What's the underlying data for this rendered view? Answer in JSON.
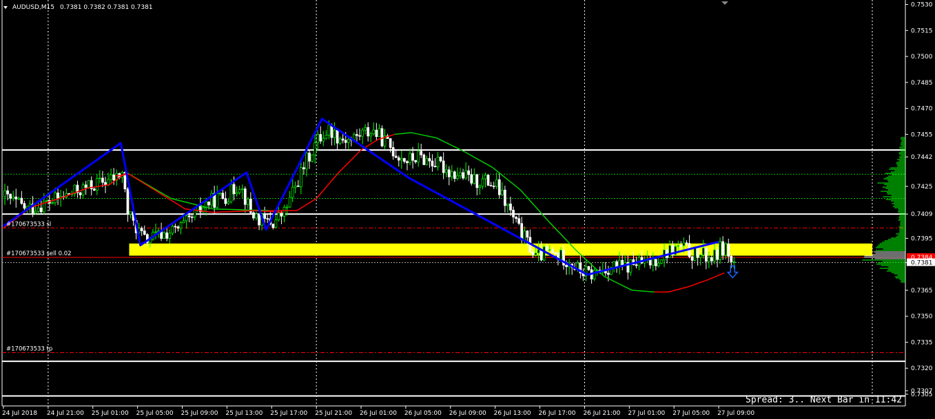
{
  "header": {
    "symbol": "AUDUSD,M15",
    "ohlc": "0.7381 0.7382 0.7381 0.7381"
  },
  "status": {
    "spread": "Spread: 3.. Next Bar in 11:42"
  },
  "orders": {
    "sl_label": "#170673533 sl",
    "sell_label": "#170673533 sell 0.02",
    "tp_label": "#170673533 tp"
  },
  "colors": {
    "background": "#000000",
    "bull_candle": "#00ff00",
    "bear_candle": "#ffffff",
    "zigzag": "#0000ff",
    "ma_green": "#00cc00",
    "ma_red": "#ff0000",
    "zone": "#ffff00",
    "order_line": "#ff0000",
    "grid": "#ffffff",
    "volume_profile": "#00ff00",
    "bid_badge": "#ff0000",
    "arrow": "#1e64ff"
  },
  "chart_data": {
    "type": "candlestick",
    "symbol": "AUDUSD",
    "timeframe": "M15",
    "ylim": [
      0.7303,
      0.7531
    ],
    "yticks": [
      "0.7530",
      "0.7515",
      "0.7500",
      "0.7485",
      "0.7470",
      "0.7455",
      "0.7442",
      "0.7425",
      "0.7409",
      "0.7395",
      "0.7381",
      "0.7365",
      "0.7350",
      "0.7335",
      "0.7320",
      "0.7307",
      "0.7305"
    ],
    "y_tick_values": [
      0.753,
      0.7515,
      0.75,
      0.7485,
      0.747,
      0.7455,
      0.7442,
      0.7425,
      0.7409,
      0.7395,
      0.7381,
      0.7365,
      0.735,
      0.7335,
      0.732,
      0.7307,
      0.7305
    ],
    "xticks": [
      "24 Jul 2018",
      "24 Jul 21:00",
      "25 Jul 01:00",
      "25 Jul 05:00",
      "25 Jul 09:00",
      "25 Jul 13:00",
      "25 Jul 17:00",
      "25 Jul 21:00",
      "26 Jul 01:00",
      "26 Jul 05:00",
      "26 Jul 09:00",
      "26 Jul 13:00",
      "26 Jul 17:00",
      "26 Jul 21:00",
      "27 Jul 01:00",
      "27 Jul 05:00",
      "27 Jul 09:00"
    ],
    "x_label_index": [
      0,
      16,
      32,
      48,
      64,
      80,
      96,
      112,
      128,
      144,
      160,
      176,
      192,
      208,
      224,
      240,
      256
    ],
    "vertical_grid_at_labels": [
      "24 Jul 21:00",
      "25 Jul 21:00",
      "26 Jul 21:00"
    ],
    "num_bars": 262,
    "price_path": [
      [
        0,
        0.7419
      ],
      [
        8,
        0.7412
      ],
      [
        16,
        0.7416
      ],
      [
        24,
        0.7421
      ],
      [
        32,
        0.7426
      ],
      [
        40,
        0.743
      ],
      [
        42,
        0.7433
      ],
      [
        44,
        0.741
      ],
      [
        46,
        0.7404
      ],
      [
        50,
        0.7394
      ],
      [
        56,
        0.7397
      ],
      [
        62,
        0.74
      ],
      [
        66,
        0.7405
      ],
      [
        72,
        0.7415
      ],
      [
        76,
        0.7418
      ],
      [
        80,
        0.742
      ],
      [
        84,
        0.7427
      ],
      [
        88,
        0.741
      ],
      [
        92,
        0.7405
      ],
      [
        96,
        0.7404
      ],
      [
        100,
        0.741
      ],
      [
        104,
        0.7425
      ],
      [
        108,
        0.744
      ],
      [
        112,
        0.7452
      ],
      [
        116,
        0.7458
      ],
      [
        120,
        0.7453
      ],
      [
        124,
        0.7452
      ],
      [
        128,
        0.7456
      ],
      [
        132,
        0.7457
      ],
      [
        136,
        0.7451
      ],
      [
        140,
        0.7444
      ],
      [
        144,
        0.744
      ],
      [
        148,
        0.7442
      ],
      [
        152,
        0.744
      ],
      [
        156,
        0.7437
      ],
      [
        160,
        0.7433
      ],
      [
        164,
        0.7431
      ],
      [
        168,
        0.7428
      ],
      [
        172,
        0.7428
      ],
      [
        176,
        0.7425
      ],
      [
        180,
        0.7413
      ],
      [
        184,
        0.74
      ],
      [
        188,
        0.739
      ],
      [
        190,
        0.7384
      ],
      [
        194,
        0.7387
      ],
      [
        198,
        0.7385
      ],
      [
        202,
        0.7382
      ],
      [
        206,
        0.7376
      ],
      [
        210,
        0.7374
      ],
      [
        214,
        0.7377
      ],
      [
        218,
        0.7379
      ],
      [
        222,
        0.7378
      ],
      [
        226,
        0.7381
      ],
      [
        230,
        0.738
      ],
      [
        234,
        0.7384
      ],
      [
        238,
        0.7388
      ],
      [
        242,
        0.739
      ],
      [
        246,
        0.7386
      ],
      [
        250,
        0.7385
      ],
      [
        254,
        0.7384
      ],
      [
        256,
        0.7389
      ],
      [
        258,
        0.739
      ],
      [
        260,
        0.7381
      ]
    ],
    "zigzag": [
      [
        0,
        0.7402
      ],
      [
        42,
        0.745
      ],
      [
        49,
        0.7391
      ],
      [
        87,
        0.7433
      ],
      [
        94,
        0.74
      ],
      [
        114,
        0.7464
      ],
      [
        145,
        0.743
      ],
      [
        209,
        0.7374
      ],
      [
        256,
        0.7393
      ]
    ],
    "ma_fast": [
      [
        0,
        0.7401
      ],
      [
        10,
        0.7413
      ],
      [
        20,
        0.7418
      ],
      [
        30,
        0.7424
      ],
      [
        38,
        0.7426
      ],
      [
        44,
        0.7433
      ],
      [
        60,
        0.7418
      ],
      [
        75,
        0.7412
      ],
      [
        95,
        0.7411
      ],
      [
        105,
        0.7411
      ],
      [
        112,
        0.7418
      ],
      [
        120,
        0.7433
      ],
      [
        128,
        0.7446
      ],
      [
        134,
        0.7452
      ],
      [
        140,
        0.7455
      ],
      [
        146,
        0.7456
      ],
      [
        155,
        0.7453
      ],
      [
        165,
        0.7445
      ],
      [
        175,
        0.7436
      ],
      [
        185,
        0.7423
      ],
      [
        195,
        0.7405
      ],
      [
        205,
        0.7388
      ],
      [
        215,
        0.7373
      ],
      [
        225,
        0.7365
      ],
      [
        233,
        0.7364
      ],
      [
        238,
        0.7364
      ],
      [
        245,
        0.7367
      ],
      [
        252,
        0.7371
      ],
      [
        258,
        0.7375
      ]
    ],
    "ma_fast_red_segments": [
      [
        0,
        44
      ],
      [
        96,
        140
      ],
      [
        235,
        258
      ]
    ],
    "ma_slow": [
      [
        40,
        0.7431
      ],
      [
        45,
        0.7432
      ],
      [
        55,
        0.7422
      ],
      [
        65,
        0.7412
      ],
      [
        75,
        0.741
      ],
      [
        90,
        0.7411
      ],
      [
        100,
        0.741
      ]
    ],
    "support_zone": {
      "from": 0.7385,
      "to": 0.7392,
      "start_bar": 45
    },
    "horizontal_levels": [
      0.7446,
      0.7409,
      0.7324,
      0.7304
    ],
    "dotted_levels": [
      0.7432,
      0.7418,
      0.7381
    ],
    "orders": {
      "sl": 0.7401,
      "sell": 0.7384,
      "tp": 0.7329
    },
    "bid": 0.7384,
    "last_price": 0.7381,
    "volume_profile_peak": 0.7385
  }
}
